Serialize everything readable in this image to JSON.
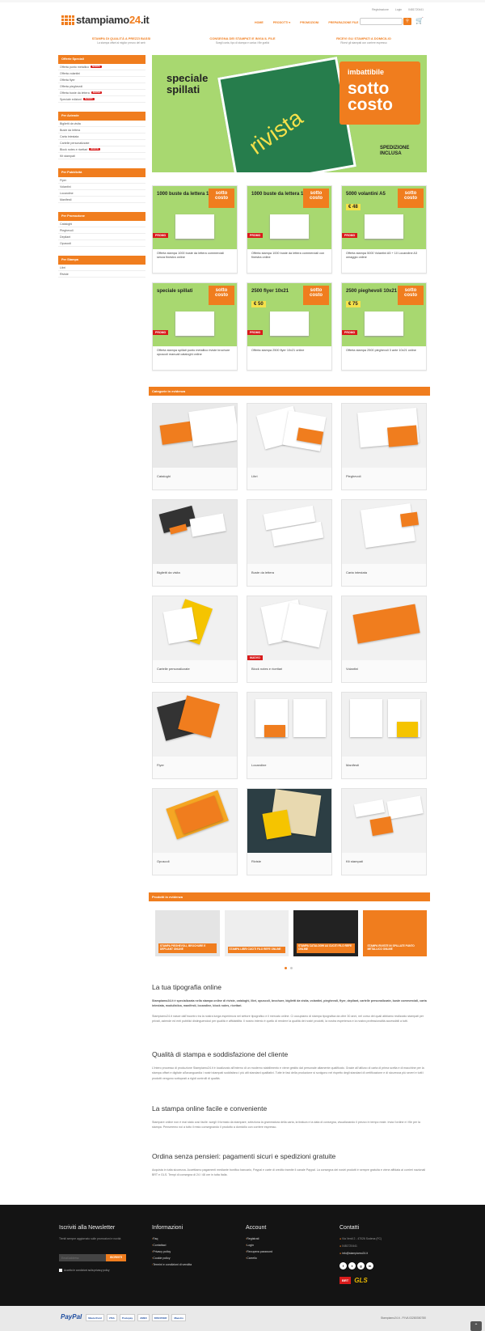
{
  "header": {
    "links": [
      "Registrazione",
      "Login",
      "0481720441"
    ],
    "logo_pre": "stampiamo",
    "logo_num": "24",
    "logo_suf": ".it",
    "nav": [
      "HOME",
      "PRODOTTI",
      "PROMOZIONI",
      "PREPARAZIONE FILE"
    ],
    "search_icon": "search-icon",
    "cart_count": "0"
  },
  "usp": [
    {
      "title": "STAMPA DI QUALITÀ A PREZZI BASSI",
      "sub": "La stampa offset al miglior prezzo del web"
    },
    {
      "title": "CONSEGNA DEI STAMPATI E INVIA IL FILE",
      "sub": "Scegli carta, tipo di stampa e carica i file grafici"
    },
    {
      "title": "RICEVI GLI STAMPATI A DOMICILIO",
      "sub": "Ricevi gli stampati con corriere espresso"
    }
  ],
  "sidebar": [
    {
      "title": "Offerte Speciali",
      "items": [
        {
          "label": "Offerta punto metallico",
          "badge": "NUOVO"
        },
        {
          "label": "Offerta volantini",
          "badge": ""
        },
        {
          "label": "Offerta flyer",
          "badge": ""
        },
        {
          "label": "Offerta pieghevoli",
          "badge": ""
        },
        {
          "label": "Offerta buste da lettera",
          "badge": "NUOVO"
        },
        {
          "label": "Speciale edizioni",
          "badge": "NUOVO"
        }
      ]
    },
    {
      "title": "Per Aziende",
      "items": [
        {
          "label": "Biglietti da visita",
          "badge": ""
        },
        {
          "label": "Buste da lettera",
          "badge": ""
        },
        {
          "label": "Carta intestata",
          "badge": ""
        },
        {
          "label": "Cartelle personalizzate",
          "badge": ""
        },
        {
          "label": "Block notes e ricettari",
          "badge": "NUOVO"
        },
        {
          "label": "Kit stampati",
          "badge": ""
        }
      ]
    },
    {
      "title": "Per Pubblicità",
      "items": [
        {
          "label": "Flyer",
          "badge": ""
        },
        {
          "label": "Volantini",
          "badge": ""
        },
        {
          "label": "Locandine",
          "badge": ""
        },
        {
          "label": "Manifesti",
          "badge": ""
        }
      ]
    },
    {
      "title": "Per Promozione",
      "items": [
        {
          "label": "Cataloghi",
          "badge": ""
        },
        {
          "label": "Pieghevoli",
          "badge": ""
        },
        {
          "label": "Depliant",
          "badge": ""
        },
        {
          "label": "Opuscoli",
          "badge": ""
        }
      ]
    },
    {
      "title": "Per Stampa",
      "items": [
        {
          "label": "Libri",
          "badge": ""
        },
        {
          "label": "Riviste",
          "badge": ""
        }
      ]
    }
  ],
  "hero": {
    "title_1": "speciale",
    "title_2": "spillati",
    "badge_1": "imbattibile",
    "badge_2": "sotto",
    "badge_3": "costo",
    "magazine": "rivista",
    "ship_1": "SPEDIZIONE",
    "ship_2": "INCLUSA"
  },
  "offers": [
    {
      "title": "1000 buste da lettera 11x23",
      "price": "",
      "promo": "PROMO",
      "caption": "Offerta stampa 1000 buste da lettera commerciali senza finestra online"
    },
    {
      "title": "1000 buste da lettera 11x23",
      "price": "",
      "promo": "PROMO",
      "caption": "Offerta stampa 1000 buste da lettera commerciali con finestra online"
    },
    {
      "title": "5000 volantini A5",
      "price": "€ 48",
      "promo": "PROMO",
      "caption": "Offerta stampa 5000 Volantini A5 + 10 Locandine A3 omaggio online"
    },
    {
      "title": "speciale spillati",
      "price": "",
      "promo": "PROMO",
      "caption": "Offerta stampa spillati punto metallico riviste brochure opuscoli manuali cataloghi online"
    },
    {
      "title": "2500 flyer 10x21",
      "price": "€ 50",
      "promo": "PROMO",
      "caption": "Offerta stampa 2500 flyer 10x21 online"
    },
    {
      "title": "2500 pieghevoli 10x21",
      "price": "€ 75",
      "promo": "PROMO",
      "caption": "Offerta stampa 2500 pieghevoli 3 ante 10x21 online"
    }
  ],
  "offer_badge": {
    "l1": "sotto",
    "l2": "costo"
  },
  "categories_title": "Categorie in evidenza",
  "categories": [
    "Cataloghi",
    "Libri",
    "Pieghevoli",
    "Biglietti da visita",
    "Buste da lettera",
    "Carta intestata",
    "Cartelle personalizzate",
    "Block notes e ricettari",
    "Volantini",
    "Flyer",
    "Locandine",
    "Manifesti",
    "Opuscoli",
    "Riviste",
    "Kit stampati"
  ],
  "nuovo_badge": "NUOVO",
  "featured_title": "Prodotti in evidenza",
  "featured": [
    "STAMPA PIEGHEVOLI, BROCHURE E DEPLIANT ONLINE",
    "STAMPA LIBRI CUCITI FILO REFE ONLINE",
    "STAMPA CATALOGHI A4 CUCITI FILO REFE ONLINE",
    "STAMPA RIVISTE IN SPILLATE PUNTO METALLICO ONLINE"
  ],
  "content": [
    {
      "heading": "La tua tipografia online",
      "paras": [
        "Stampiamo24.it è specializzata nella stampa online di riviste, cataloghi, libri, opuscoli, brochure, biglietti da visita, volantini, pieghevoli, flyer, depliant, cartelle personalizzate, buste commerciali, carta intestata, modulistica, manifesti, locandine, block notes, ricettari.",
        "Stampiamo24.it nasce dall'incontro tra la nostra lunga esperienza nel settore tipografico e il mercato online. Ci occupiamo di stampa tipografica da oltre 30 anni, nel corso dei quali abbiamo realizzato stampati per privati, aziende ed enti pubblici distinguendoci per qualità e affidabilità. Il nostro intento è quello di rendere la qualità dei nostri prodotti, la nostra esperienza e la nostra professionalità accessibili a tutti."
      ]
    },
    {
      "heading": "Qualità di stampa e soddisfazione del cliente",
      "paras": [
        "L'intero processo di produzione Stampiamo24.it è localizzato all'interno di un moderno stabilimento e viene gestito dal personale altamente qualificato. Grazie all'utilizzo di carta di prima scelta e di macchine per la stampa offset e digitale all'avanguardia i nostri stampati soddisfano i più alti standard qualitativi. Tutte le fasi della produzione si svolgono nel rispetto degli standard di certificazione e di sicurezza più severi e tutti i prodotti vengono sottoposti a rigidi controlli di qualità."
      ]
    },
    {
      "heading": "La stampa online facile e conveniente",
      "paras": [
        "Stampare online non è mai stato così facile: scegli il formato da stampare, seleziona la grammatura della carta, la tiratura e la data di consegna, visualizzando il prezzo in tempo reale. Invia l'ordine e i file per la stampa. Penseremo noi a tutto il resto consegnando il prodotto a domicilio con corriere espresso."
      ]
    },
    {
      "heading": "Ordina senza pensieri: pagamenti sicuri e spedizioni gratuite",
      "paras": [
        "Acquista in tutta sicurezza. Accettiamo pagamenti mediante bonifico bancario, Paypal e carte di credito tramite il canale Paypal. La consegna dei nostri prodotti è sempre gratuita e viene affidata ai corrieri nazionali BRT e GLS. Tempi di consegna di 24 / 48 ore in tutta Italia."
      ]
    }
  ],
  "footer": {
    "newsletter_title": "Iscriviti alla Newsletter",
    "newsletter_text": "Tieniti sempre aggiornato sulle promozioni e novità",
    "newsletter_placeholder": "Email address",
    "newsletter_btn": "ISCRIVITI",
    "privacy": "Accetto le condizioni sulla privacy policy",
    "info_title": "Informazioni",
    "info": [
      "Faq",
      "Contattaci",
      "Privacy policy",
      "Cookie policy",
      "Termini e condizioni di vendita"
    ],
    "account_title": "Account",
    "account": [
      "Registrati",
      "Login",
      "Recupera password",
      "Carrello"
    ],
    "contact_title": "Contatti",
    "contact": [
      "Via Verdi 2 - 47026 Sodena (FC)",
      "0481720441",
      "info@stampiamo24.it"
    ],
    "social": [
      "f",
      "t",
      "g",
      "in"
    ],
    "couriers": [
      "BRT",
      "GLS"
    ],
    "payments": [
      "PayPal",
      "MasterCard",
      "VISA",
      "Postepay",
      "AMEX",
      "DISCOVER",
      "Maestro"
    ],
    "copyright": "Stampiamo24.it - P.IVA 03280350780"
  },
  "colors": {
    "accent": "#f07d1e",
    "promo": "#d81b1b",
    "hero_bg": "#a8d870"
  }
}
